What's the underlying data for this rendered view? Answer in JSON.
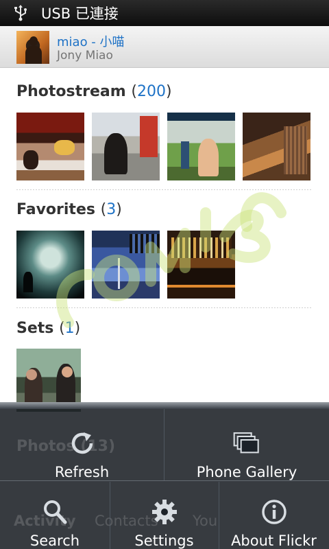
{
  "status_bar": {
    "usb_icon": "usb-icon",
    "text": "USB 已連接"
  },
  "profile": {
    "name": "miao - 小喵",
    "subtitle": "Jony Miao"
  },
  "sections": {
    "photostream": {
      "title": "Photostream",
      "open": "(",
      "count": "200",
      "close": ")"
    },
    "favorites": {
      "title": "Favorites",
      "open": "(",
      "count": "3",
      "close": ")"
    },
    "sets": {
      "title": "Sets",
      "open": "(",
      "count": "1",
      "close": ")"
    },
    "photos": {
      "title": "Photos",
      "count": "(13)"
    }
  },
  "bottom_tabs": [
    "Activity",
    "Contacts",
    "You"
  ],
  "menu": {
    "refresh": {
      "label": "Refresh",
      "icon": "refresh-icon"
    },
    "phone_gallery": {
      "label": "Phone Gallery",
      "icon": "gallery-icon"
    },
    "search": {
      "label": "Search",
      "icon": "search-icon"
    },
    "settings": {
      "label": "Settings",
      "icon": "gear-icon"
    },
    "about": {
      "label": "About Flickr",
      "icon": "info-icon"
    }
  },
  "colors": {
    "link_blue": "#1e72c6",
    "menu_bg": "#161b21",
    "watermark": "#c9e27a"
  }
}
